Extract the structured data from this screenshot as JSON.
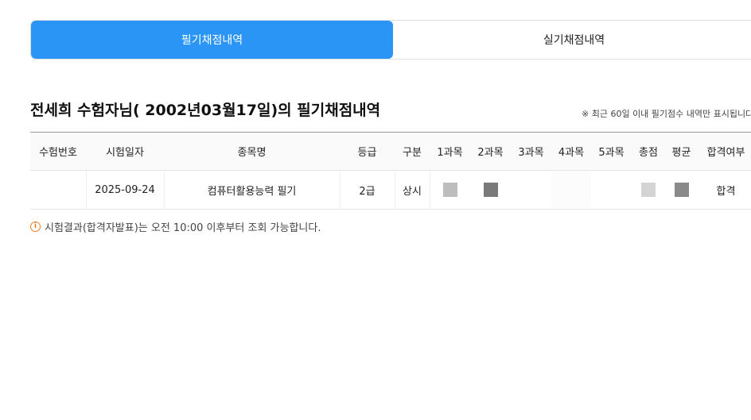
{
  "tabs": [
    {
      "label": "필기채점내역",
      "active": true
    },
    {
      "label": "실기채점내역",
      "active": false
    }
  ],
  "title": "전세희 수험자님( 2002년03월17일)의 필기채점내역",
  "notice_right": "※ 최근 60일 이내 필기점수 내역만 표시됩니다",
  "table": {
    "headers": [
      "수험번호",
      "시험일자",
      "종목명",
      "등급",
      "구분",
      "1과목",
      "2과목",
      "3과목",
      "4과목",
      "5과목",
      "총점",
      "평균",
      "합격여부"
    ],
    "row": {
      "exam_no": "",
      "date": "2025-09-24",
      "subject": "컴퓨터활용능력 필기",
      "grade": "2급",
      "type": "상시",
      "result": "합격"
    }
  },
  "footnote": "시험결과(합격자발표)는 오전 10:00 이후부터 조회 가능합니다.",
  "colors": {
    "accent": "#2b95f6",
    "info_icon": "#ef7d22",
    "mask_light": "#bdbdbd",
    "mask_dark": "#7a7a7a",
    "mask_lighter": "#d4d4d4",
    "mask_mid": "#8a8a8a"
  }
}
